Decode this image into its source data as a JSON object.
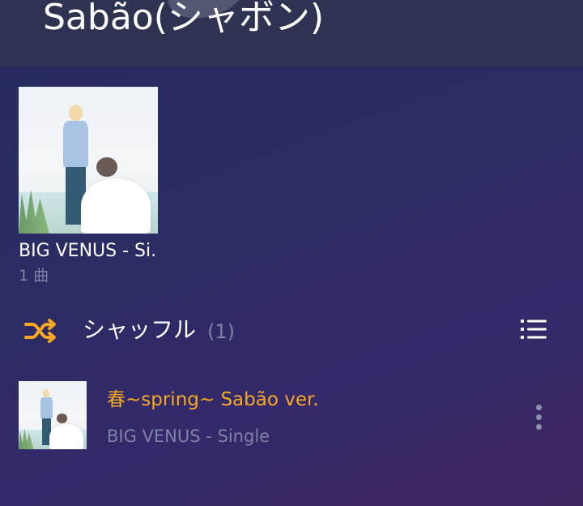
{
  "header": {
    "artist_title": "Sabão(シャボン)"
  },
  "albums": [
    {
      "title": "BIG VENUS - Si.",
      "track_count": "1 曲"
    }
  ],
  "shuffle": {
    "label": "シャッフル",
    "count": "(1)",
    "icon": "shuffle-icon",
    "icon_color": "#f6a826"
  },
  "list_icon": "list-view-icon",
  "songs": [
    {
      "title": "春~spring~ Sabão ver.",
      "album": "BIG VENUS - Single",
      "more_icon": "more-vert-icon"
    }
  ],
  "colors": {
    "accent": "#f6a826",
    "secondary_text": "#7f83a6",
    "header_bg": "#2e3352"
  }
}
